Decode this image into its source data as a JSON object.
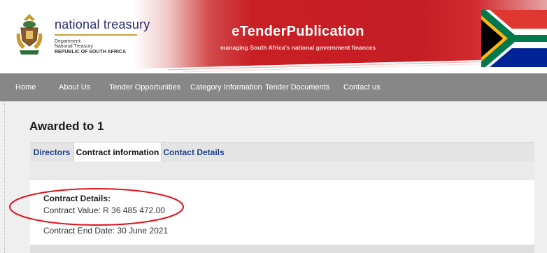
{
  "header": {
    "logo_title": "national treasury",
    "logo_line1": "Department:",
    "logo_line2": "National Treasury",
    "logo_line3": "REPUBLIC OF SOUTH AFRICA",
    "site_title": "eTenderPublication",
    "site_subtitle": "managing South Africa's national government finances",
    "icons": [
      "coat-of-arms",
      "south-africa-flag"
    ]
  },
  "nav": {
    "items": [
      {
        "label": "Home"
      },
      {
        "label": "About Us"
      },
      {
        "label": "Tender Opportunities"
      },
      {
        "label": "Category Information"
      },
      {
        "label": "Tender Documents"
      },
      {
        "label": "Contact us"
      }
    ]
  },
  "main": {
    "title": "Awarded to 1",
    "tabs": [
      {
        "label": "Directors",
        "active": false
      },
      {
        "label": "Contract information",
        "active": true
      },
      {
        "label": "Contact Details",
        "active": false
      }
    ],
    "contract_details_label": "Contract Details:",
    "contract_value_label": "Contract Value:",
    "contract_value": "R 36 485 472.00",
    "contract_end_label": "Contract End Date:",
    "contract_end_date": "30 June 2021"
  },
  "colors": {
    "header_red": "#c41e24",
    "nav_bg": "#878787",
    "tab_link": "#1c3f8a",
    "highlight_circle": "#e0141b"
  }
}
